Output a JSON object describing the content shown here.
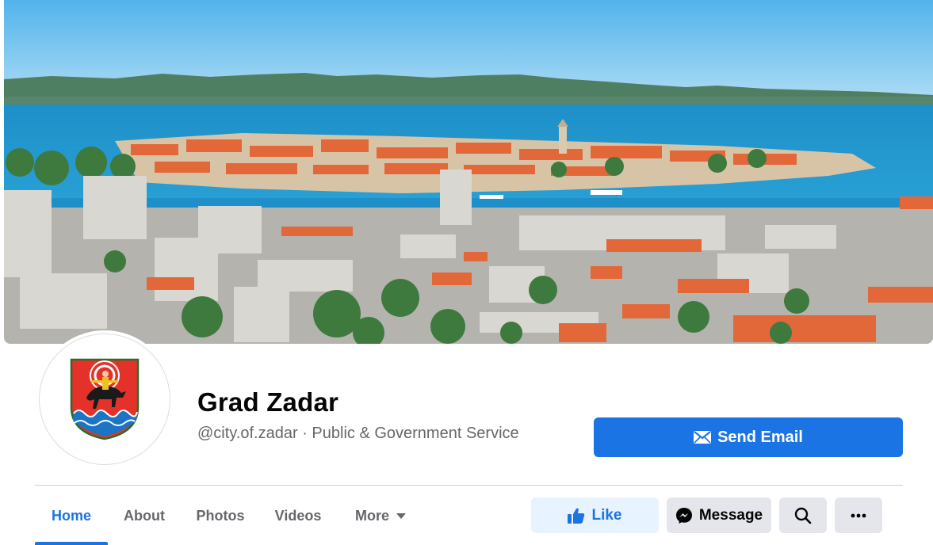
{
  "page": {
    "name": "Grad Zadar",
    "handle": "@city.of.zadar",
    "separator": " · ",
    "category": "Public & Government Service"
  },
  "cover": {
    "icon": "cover-photo-panorama",
    "colors": {
      "sky": "#7ec3ef",
      "sea": "#1d8fc8",
      "roofs": "#e2683a",
      "hills": "#4f7f63"
    }
  },
  "avatar": {
    "icon": "zadar-coat-of-arms-icon"
  },
  "cta": {
    "label": "Send Email",
    "icon": "envelope-icon"
  },
  "tabs": [
    {
      "label": "Home",
      "active": true
    },
    {
      "label": "About"
    },
    {
      "label": "Photos"
    },
    {
      "label": "Videos"
    },
    {
      "label": "More",
      "icon": "caret-down-icon"
    }
  ],
  "actions": {
    "like": {
      "label": "Like",
      "icon": "thumbs-up-icon"
    },
    "message": {
      "label": "Message",
      "icon": "messenger-icon"
    },
    "search": {
      "icon": "search-icon"
    },
    "more": {
      "icon": "more-dots-icon"
    }
  },
  "colors": {
    "accent": "#1b74e4",
    "secondary_text": "#65676b",
    "button_gray": "#e4e6eb"
  }
}
